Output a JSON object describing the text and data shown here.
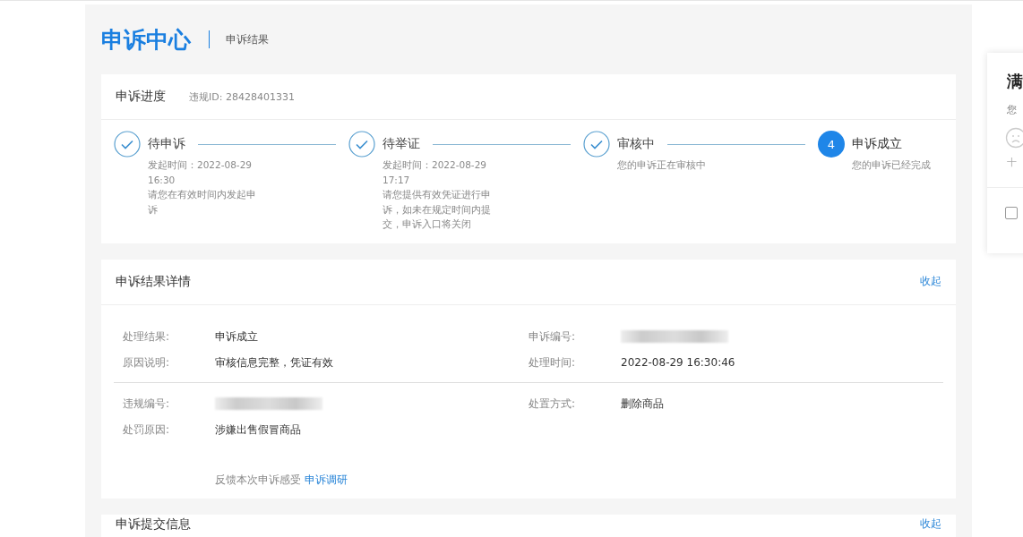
{
  "header": {
    "title": "申诉中心",
    "subtitle": "申诉结果"
  },
  "progress": {
    "title": "申诉进度",
    "violation_id": "违规ID: 28428401331",
    "steps": [
      {
        "title": "待申诉",
        "kind": "done",
        "time": "发起时间：2022-08-29 16:30",
        "note": "请您在有效时间内发起申诉"
      },
      {
        "title": "待举证",
        "kind": "done",
        "time": "发起时间：2022-08-29 17:17",
        "note": "请您提供有效凭证进行申诉，如未在规定时间内提交，申诉入口将关闭"
      },
      {
        "title": "审核中",
        "kind": "done",
        "note": "您的申诉正在审核中"
      },
      {
        "title": "申诉成立",
        "kind": "current",
        "number": "4",
        "note": "您的申诉已经完成"
      }
    ]
  },
  "result": {
    "title": "申诉结果详情",
    "toggle": "收起",
    "groups": [
      {
        "fields": [
          {
            "label": "处理结果:",
            "value": "申诉成立"
          },
          {
            "label": "申诉编号:",
            "redacted": true
          },
          {
            "label": "原因说明:",
            "value": "审核信息完整，凭证有效"
          },
          {
            "label": "处理时间:",
            "value": "2022-08-29 16:30:46"
          }
        ]
      },
      {
        "fields": [
          {
            "label": "违规编号:",
            "redacted": true
          },
          {
            "label": "处置方式:",
            "value": "删除商品"
          },
          {
            "label": "处罚原因:",
            "value": "涉嫌出售假冒商品"
          }
        ]
      }
    ],
    "feedback": {
      "text": "反馈本次申诉感受",
      "link": "申诉调研"
    }
  },
  "submission": {
    "title": "申诉提交信息",
    "toggle": "收起"
  },
  "survey_panel": {
    "title": "满",
    "question": "您",
    "option": "十",
    "checked": false
  }
}
